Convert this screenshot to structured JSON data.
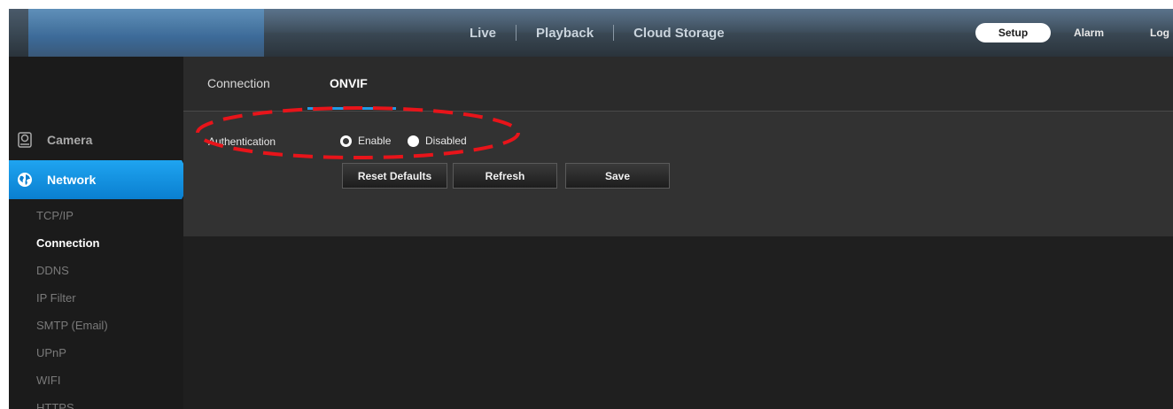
{
  "topnav": {
    "items": [
      "Live",
      "Playback",
      "Cloud Storage"
    ],
    "setup_label": "Setup",
    "alarm_label": "Alarm",
    "logout_label": "Log"
  },
  "sidebar": {
    "categories": [
      {
        "label": "Camera",
        "icon": "camera-icon"
      },
      {
        "label": "Network",
        "icon": "network-globe-icon"
      }
    ],
    "subitems": [
      "TCP/IP",
      "Connection",
      "DDNS",
      "IP Filter",
      "SMTP (Email)",
      "UPnP",
      "WIFI",
      "HTTPS"
    ],
    "active_subitem": "Connection"
  },
  "tabs": {
    "items": [
      "Connection",
      "ONVIF"
    ],
    "active": "ONVIF"
  },
  "form": {
    "authentication_label": "Authentication",
    "options": [
      "Enable",
      "Disabled"
    ],
    "selected": "Enable"
  },
  "buttons": {
    "reset_label": "Reset Defaults",
    "refresh_label": "Refresh",
    "save_label": "Save"
  },
  "colors": {
    "accent": "#1f9be6",
    "annotation": "#e8141a"
  }
}
